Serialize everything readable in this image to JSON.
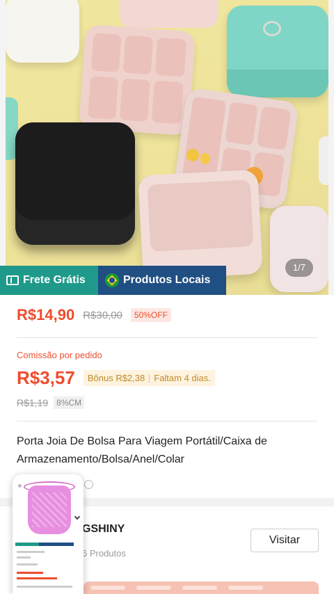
{
  "gallery": {
    "counter": "1/7",
    "badges": {
      "shipping": "Frete Grátis",
      "local": "Produtos Locais"
    }
  },
  "pricing": {
    "price": "R$14,90",
    "old_price": "R$30,00",
    "discount": "50%OFF"
  },
  "commission": {
    "label": "Comissão por pedido",
    "value": "R$3,57",
    "bonus": "Bônus R$2,38",
    "time_left": "Faltam 4 dias.",
    "old_value": "R$1,19",
    "rate": "8%CM"
  },
  "product": {
    "title": "Porta Joia De Bolsa Para Viagem Portátil/Caixa de Armazenamento/Bolsa/Anel/Colar"
  },
  "shop": {
    "name": "GSHINY",
    "products": "6 Produtos",
    "visit_label": "Visitar"
  },
  "colors": {
    "accent": "#ee4d2d",
    "shipping_badge": "#1f9a8a",
    "local_badge": "#204f83"
  },
  "icons": {
    "shipping": "truck-icon",
    "local": "brazil-flag-icon",
    "info": "info-icon"
  }
}
